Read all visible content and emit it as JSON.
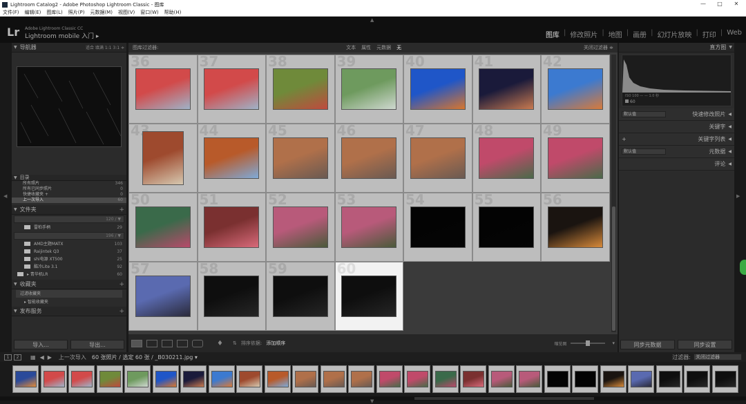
{
  "window": {
    "title": "Lightroom Catalog2 - Adobe Photoshop Lightroom Classic - 图库",
    "controls": [
      "—",
      "□",
      "✕"
    ]
  },
  "menu": [
    "文件(F)",
    "编辑(E)",
    "图库(L)",
    "照片(P)",
    "元数据(M)",
    "视图(V)",
    "窗口(W)",
    "帮助(H)"
  ],
  "identity": {
    "logo": "Lr",
    "line1": "Adobe Lightroom Classic CC",
    "line2": "Lightroom mobile 入门 ▸"
  },
  "modules": [
    {
      "label": "图库",
      "active": true
    },
    {
      "label": "修改照片",
      "active": false
    },
    {
      "label": "地图",
      "active": false
    },
    {
      "label": "画册",
      "active": false
    },
    {
      "label": "幻灯片放映",
      "active": false
    },
    {
      "label": "打印",
      "active": false
    },
    {
      "label": "Web",
      "active": false
    }
  ],
  "left_panel": {
    "navigator": {
      "title": "导航器",
      "options": "适合  填满  1:1  3:1 ≑"
    },
    "catalog": {
      "title": "目录",
      "items": [
        {
          "label": "所有照片",
          "count": "346"
        },
        {
          "label": "所有已同步照片",
          "count": "0"
        },
        {
          "label": "快捷收藏夹 +",
          "count": "0"
        },
        {
          "label": "上一次导入",
          "count": "60",
          "selected": true
        }
      ]
    },
    "folders": {
      "title": "文件夹",
      "volumes": [
        {
          "label": "",
          "count": "120 / ▼",
          "items": [
            {
              "label": "雷柏手柄",
              "count": "29"
            }
          ]
        },
        {
          "label": "",
          "count": "196 / ▼",
          "items": [
            {
              "label": "AMD主题MATX",
              "count": "103"
            },
            {
              "label": "Raijintek Q3",
              "count": "37"
            },
            {
              "label": "shi电源 XT500",
              "count": "25"
            },
            {
              "label": "酷冷Lite 3.1",
              "count": "92"
            },
            {
              "label": "▸ 青华机LR",
              "count": "60"
            }
          ]
        }
      ]
    },
    "collections": {
      "title": "收藏夹",
      "items": [
        "过滤收藏夹",
        "▸  智能收藏夹"
      ]
    },
    "publish": {
      "title": "发布服务"
    },
    "buttons": {
      "import": "导入...",
      "export": "导出..."
    }
  },
  "filter_bar": {
    "label": "图库过滤器:",
    "options": [
      "文本",
      "属性",
      "元数据",
      "无"
    ],
    "active": "无",
    "right": "关闭过滤器 ≑"
  },
  "grid": {
    "cells": [
      {
        "num": "36",
        "colors": [
          "#d24a4a",
          "#9fb3c8"
        ]
      },
      {
        "num": "37",
        "colors": [
          "#d24a4a",
          "#9fb3c8"
        ]
      },
      {
        "num": "38",
        "colors": [
          "#6f8a3a",
          "#c04a3e"
        ]
      },
      {
        "num": "39",
        "colors": [
          "#6e9a5e",
          "#cfd8d0"
        ]
      },
      {
        "num": "40",
        "colors": [
          "#1f56c8",
          "#d8762e"
        ]
      },
      {
        "num": "41",
        "colors": [
          "#1a1a3a",
          "#c87a50"
        ]
      },
      {
        "num": "42",
        "colors": [
          "#3c7ad0",
          "#d87a3a"
        ]
      },
      {
        "num": "43",
        "colors": [
          "#9e4a2e",
          "#d6c8b0"
        ]
      },
      {
        "num": "44",
        "colors": [
          "#b85a2a",
          "#7faad8"
        ]
      },
      {
        "num": "45",
        "colors": [
          "#b0704a",
          "#6a5a52"
        ]
      },
      {
        "num": "46",
        "colors": [
          "#b0704a",
          "#6a5a52"
        ]
      },
      {
        "num": "47",
        "colors": [
          "#b0704a",
          "#6a5a52"
        ]
      },
      {
        "num": "48",
        "colors": [
          "#c04a6a",
          "#4a6a4a"
        ]
      },
      {
        "num": "49",
        "colors": [
          "#c04a6a",
          "#4a6a4a"
        ]
      },
      {
        "num": "50",
        "colors": [
          "#3a6a4a",
          "#b84a6a"
        ]
      },
      {
        "num": "51",
        "colors": [
          "#7a3030",
          "#d86a7a"
        ]
      },
      {
        "num": "52",
        "colors": [
          "#b85a7a",
          "#4a5a3a"
        ]
      },
      {
        "num": "53",
        "colors": [
          "#b85a7a",
          "#4a5a3a"
        ]
      },
      {
        "num": "54",
        "colors": [
          "#030303",
          "#050505"
        ]
      },
      {
        "num": "55",
        "colors": [
          "#030303",
          "#050505"
        ]
      },
      {
        "num": "56",
        "colors": [
          "#1a1410",
          "#d88a3a"
        ]
      },
      {
        "num": "57",
        "colors": [
          "#5a6ab0",
          "#2a2a3a"
        ]
      },
      {
        "num": "58",
        "colors": [
          "#0e0e0e",
          "#262626"
        ]
      },
      {
        "num": "59",
        "colors": [
          "#0e0e0e",
          "#262626"
        ]
      },
      {
        "num": "60",
        "colors": [
          "#0e0e0e",
          "#262626"
        ],
        "highlight": true
      }
    ]
  },
  "toolbar": {
    "sort_label": "排序依据:",
    "sort_value": "添加顺序",
    "thumb_label": "缩览图"
  },
  "right_panel": {
    "histogram": {
      "title": "直方图",
      "info": "ISO 100        —        —        1.0 秒",
      "zoom": "60"
    },
    "quick_develop": {
      "preset": "默认值",
      "title": "快速修改照片"
    },
    "keywords": {
      "title": "关键字"
    },
    "keyword_list": {
      "title": "关键字列表"
    },
    "metadata": {
      "preset": "默认值",
      "title": "元数据"
    },
    "comments": {
      "title": "评论"
    },
    "buttons": {
      "sync_meta": "同步元数据",
      "sync_settings": "同步设置"
    }
  },
  "filmstrip_bar": {
    "pages": [
      "1",
      "2"
    ],
    "source": "上一次导入",
    "count": "60 张照片 / 选定 60 张 / _B030211.jpg ▾",
    "filter_label": "过滤器:",
    "filter_value": "关闭过滤器"
  },
  "filmstrip": {
    "items": [
      {
        "colors": [
          "#2a4a9a",
          "#e08a3a"
        ]
      },
      {
        "colors": [
          "#d24a4a",
          "#9fb3c8"
        ]
      },
      {
        "colors": [
          "#d24a4a",
          "#9fb3c8"
        ]
      },
      {
        "colors": [
          "#6f8a3a",
          "#c04a3e"
        ]
      },
      {
        "colors": [
          "#6e9a5e",
          "#cfd8d0"
        ]
      },
      {
        "colors": [
          "#1f56c8",
          "#d8762e"
        ]
      },
      {
        "colors": [
          "#1a1a3a",
          "#c87a50"
        ]
      },
      {
        "colors": [
          "#3c7ad0",
          "#d87a3a"
        ]
      },
      {
        "colors": [
          "#9e4a2e",
          "#d6c8b0"
        ]
      },
      {
        "colors": [
          "#b85a2a",
          "#7faad8"
        ]
      },
      {
        "colors": [
          "#b0704a",
          "#6a5a52"
        ]
      },
      {
        "colors": [
          "#b0704a",
          "#6a5a52"
        ]
      },
      {
        "colors": [
          "#b0704a",
          "#6a5a52"
        ]
      },
      {
        "colors": [
          "#c04a6a",
          "#4a6a4a"
        ]
      },
      {
        "colors": [
          "#c04a6a",
          "#4a6a4a"
        ]
      },
      {
        "colors": [
          "#3a6a4a",
          "#b84a6a"
        ]
      },
      {
        "colors": [
          "#7a3030",
          "#d86a7a"
        ]
      },
      {
        "colors": [
          "#b85a7a",
          "#4a5a3a"
        ]
      },
      {
        "colors": [
          "#b85a7a",
          "#4a5a3a"
        ]
      },
      {
        "colors": [
          "#030303",
          "#050505"
        ]
      },
      {
        "colors": [
          "#030303",
          "#050505"
        ]
      },
      {
        "colors": [
          "#1a1410",
          "#d88a3a"
        ]
      },
      {
        "colors": [
          "#5a6ab0",
          "#2a2a3a"
        ]
      },
      {
        "colors": [
          "#0e0e0e",
          "#262626"
        ]
      },
      {
        "colors": [
          "#0e0e0e",
          "#262626"
        ]
      },
      {
        "colors": [
          "#0e0e0e",
          "#262626"
        ]
      }
    ]
  }
}
